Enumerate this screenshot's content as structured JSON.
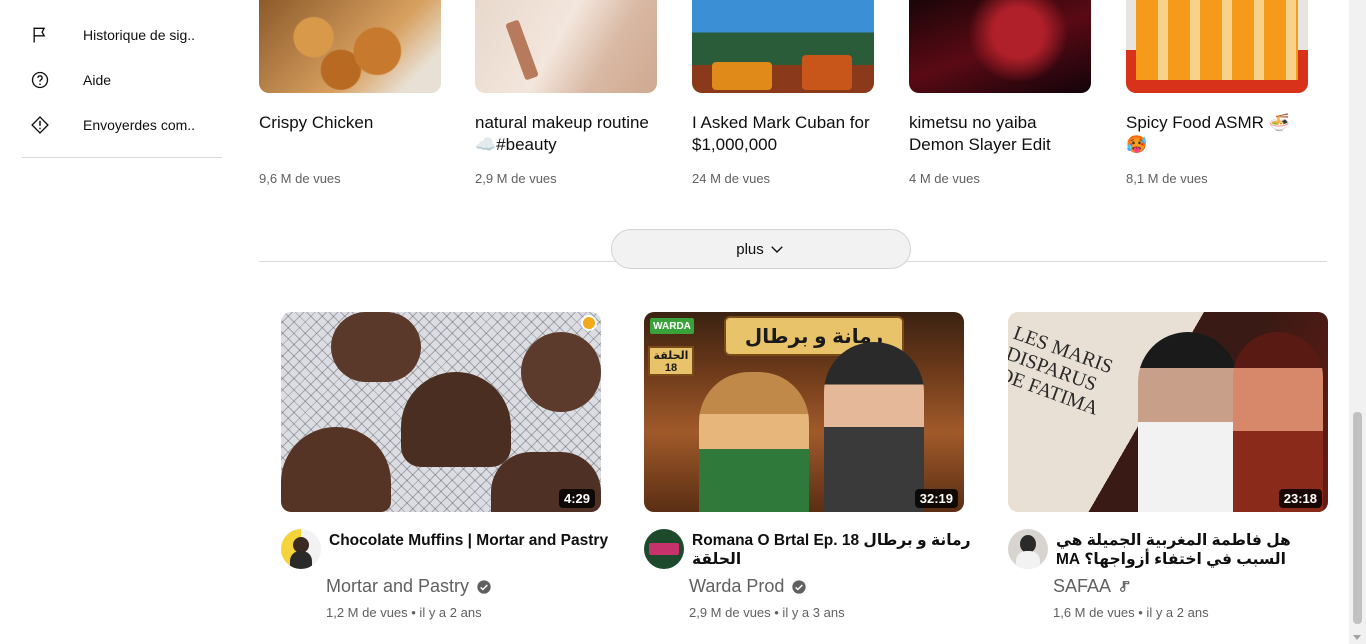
{
  "sidebar": {
    "items": [
      {
        "label": "Historique de sig..",
        "icon": "flag-icon"
      },
      {
        "label": "Aide",
        "icon": "help-icon"
      },
      {
        "label": "Envoyerdes com..",
        "icon": "feedback-icon"
      }
    ]
  },
  "shorts": [
    {
      "title": "Crispy Chicken",
      "views": "9,6 M de vues"
    },
    {
      "title": "natural makeup routine ☁️#beauty",
      "views": "2,9 M de vues"
    },
    {
      "title": "I Asked Mark Cuban for $1,000,000",
      "views": "24 M de vues"
    },
    {
      "title": "kimetsu no yaiba Demon Slayer Edit",
      "views": "4 M de vues"
    },
    {
      "title": "Spicy Food ASMR 🍜🥵",
      "views": "8,1 M de vues"
    }
  ],
  "more_button": {
    "label": "plus"
  },
  "videos": [
    {
      "title": "Chocolate Muffins | Mortar and Pastry",
      "duration": "4:29",
      "channel": "Mortar and Pastry",
      "verified": true,
      "meta": "1,2 M de vues • il y a 2 ans"
    },
    {
      "title": "Romana O Brtal Ep. 18 رمانة و برطال الحلقة",
      "duration": "32:19",
      "channel": "Warda Prod",
      "verified": true,
      "thumb_text_top": "رمانة و برطال",
      "thumb_text_badge": "الحلقة 18",
      "thumb_logo": "WARDA",
      "meta": "2,9 M de vues • il y a 3 ans"
    },
    {
      "title": "هل فاطمة المغربية الجميلة هي السبب في اختفاء أزواجها؟ MA",
      "duration": "23:18",
      "channel": "SAFAA",
      "channel_icon": "music-note-icon",
      "thumb_text": "LES MARIS DISPARUS DE FATIMA",
      "meta": "1,6 M de vues • il y a 2 ans"
    }
  ]
}
